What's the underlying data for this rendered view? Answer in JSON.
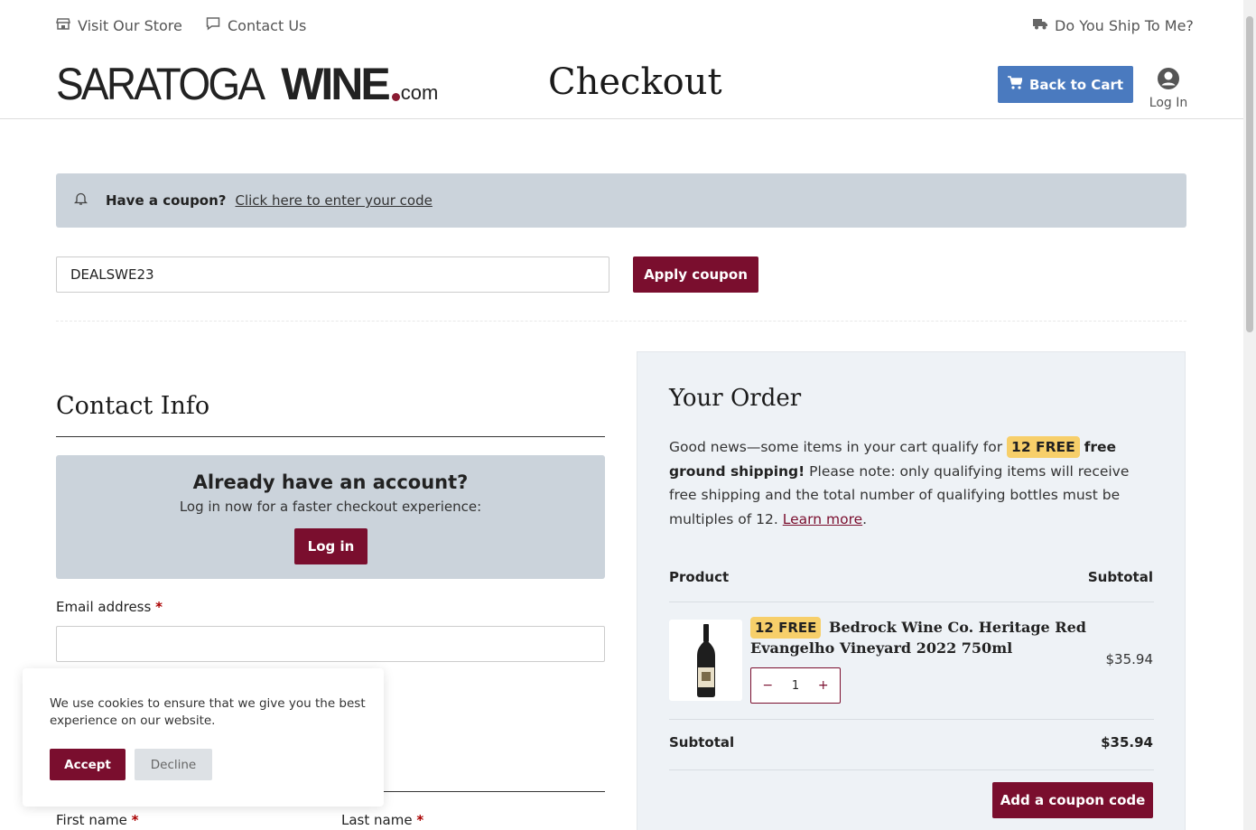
{
  "topbar": {
    "visit_store": "Visit Our Store",
    "contact_us": "Contact Us",
    "ship": "Do You Ship To Me?"
  },
  "header": {
    "logo_light": "SARATOGA",
    "logo_bold": "WINE",
    "logo_suffix": "com",
    "title": "Checkout",
    "back_to_cart": "Back to Cart",
    "log_in": "Log In"
  },
  "coupon": {
    "question": "Have a coupon?",
    "link": "Click here to enter your code",
    "value": "DEALSWE23",
    "apply": "Apply coupon"
  },
  "contact": {
    "title": "Contact Info",
    "account_heading": "Already have an account?",
    "account_sub": "Log in now for a faster checkout experience:",
    "login_button": "Log in",
    "email_label": "Email address",
    "first_name_label": "First name",
    "last_name_label": "Last name",
    "required_mark": "*"
  },
  "cookie": {
    "message": "We use cookies to ensure that we give you the best experience on our website.",
    "accept": "Accept",
    "decline": "Decline"
  },
  "order": {
    "title": "Your Order",
    "news_prefix": "Good news—some items in your cart qualify for",
    "badge": "12 FREE",
    "news_bold": "free ground shipping!",
    "news_rest": "Please note: only qualifying items will receive free shipping and the total number of qualifying bottles must be multiples of 12.",
    "learn_more": "Learn more",
    "news_end": ".",
    "col_product": "Product",
    "col_subtotal": "Subtotal",
    "item": {
      "badge": "12 FREE",
      "name": "Bedrock Wine Co. Heritage Red Evangelho Vineyard 2022 750ml",
      "qty": "1",
      "minus": "−",
      "plus": "+",
      "price": "$35.94"
    },
    "subtotal_label": "Subtotal",
    "subtotal_value": "$35.94",
    "add_coupon": "Add a coupon code"
  },
  "colors": {
    "brand": "#7a0e2e",
    "accent_blue": "#4a7abf",
    "badge": "#f7cf6a"
  },
  "icons": [
    "store-icon",
    "chat-icon",
    "truck-icon",
    "cart-icon",
    "user-icon",
    "bell-icon",
    "wine-bottle-image"
  ]
}
